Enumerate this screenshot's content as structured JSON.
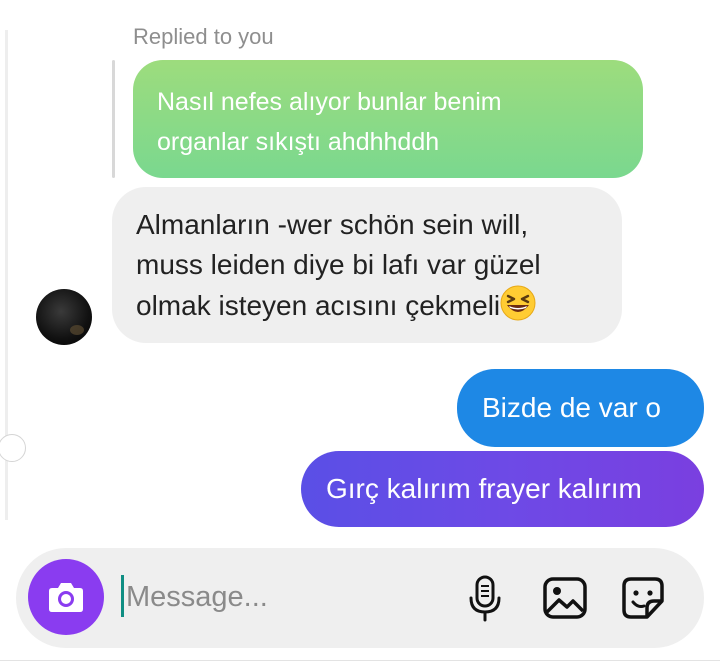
{
  "thread": {
    "reply_label": "Replied to you",
    "replied_message": {
      "line1": "Nasıl nefes alıyor bunlar benim",
      "line2": "organlar sıkıştı ahdhhddh"
    },
    "received_message": {
      "line1": "Almanların -wer schön sein will,",
      "line2": "muss leiden diye bi lafı var güzel",
      "line3": "olmak isteyen acısını çekmeli",
      "emoji": "grinning-squinting-face"
    },
    "sent_messages": [
      {
        "text": "Bizde de var o"
      },
      {
        "text": "Gırç kalırım frayer kalırım"
      }
    ]
  },
  "composer": {
    "placeholder": "Message...",
    "value": ""
  },
  "colors": {
    "replied_bubble": "#8fdc85",
    "received_bubble": "#efefef",
    "sent_bubble_blue": "#1e88e5",
    "sent_bubble_purple": "#6a4ae6",
    "camera_button": "#8a3cf0",
    "caret": "#0f8e83"
  },
  "icons": {
    "camera": "camera-icon",
    "mic": "microphone-icon",
    "gallery": "image-gallery-icon",
    "sticker": "sticker-icon"
  }
}
